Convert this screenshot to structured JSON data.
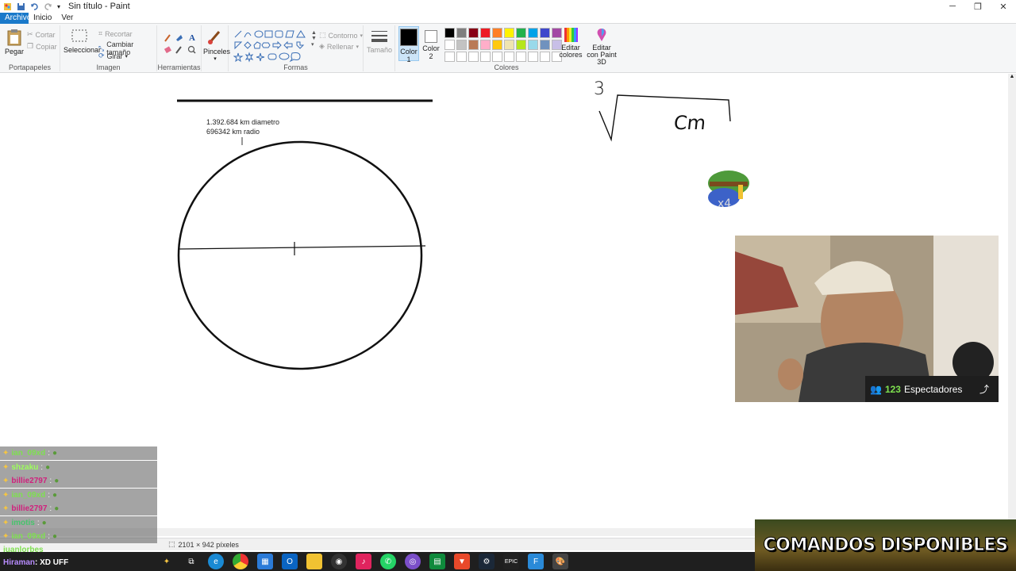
{
  "window": {
    "title": "Sin título - Paint",
    "controls": {
      "minimize": "─",
      "maximize": "❐",
      "close": "✕"
    }
  },
  "menu": {
    "tabs": [
      "Archivo",
      "Inicio",
      "Ver"
    ]
  },
  "ribbon": {
    "clipboard": {
      "label": "Portapapeles",
      "paste": "Pegar",
      "cut": "Cortar",
      "copy": "Copiar"
    },
    "image": {
      "label": "Imagen",
      "select": "Seleccionar",
      "crop": "Recortar",
      "resize": "Cambiar tamaño",
      "rotate": "Girar"
    },
    "tools": {
      "label": "Herramientas"
    },
    "brushes": {
      "label": "Pinceles"
    },
    "shapes": {
      "label": "Formas",
      "outline": "Contorno",
      "fill": "Rellenar"
    },
    "size": {
      "label": "Tamaño"
    },
    "colors": {
      "label": "Colores",
      "color1": "Color 1",
      "color2": "Color 2",
      "edit": "Editar colores",
      "paint3d": "Editar con Paint 3D",
      "color1_value": "#000000",
      "color2_value": "#ffffff",
      "palette": [
        "#000000",
        "#7f7f7f",
        "#880015",
        "#ed1c24",
        "#ff7f27",
        "#fff200",
        "#22b14c",
        "#00a2e8",
        "#3f48cc",
        "#a349a4",
        "#ffffff",
        "#c3c3c3",
        "#b97a57",
        "#ffaec9",
        "#ffc90e",
        "#efe4b0",
        "#b5e61d",
        "#99d9ea",
        "#7092be",
        "#c8bfe7",
        "#ffffff",
        "#ffffff",
        "#ffffff",
        "#ffffff",
        "#ffffff",
        "#ffffff",
        "#ffffff",
        "#ffffff",
        "#ffffff",
        "#ffffff"
      ]
    }
  },
  "canvas": {
    "note_line1": "1.392.684 km diametro",
    "note_line2": "696342 km radio",
    "handwriting_index": "3",
    "handwriting_unit": "Cm"
  },
  "status": {
    "dimensions": "2101 × 942 píxeles"
  },
  "stream": {
    "viewers_count": "123",
    "viewers_label": "Espectadores",
    "commands": "COMANDOS DISPONIBLES",
    "chat": [
      {
        "user": "ian_09xd",
        "color": "#7ee04f",
        "msg": ""
      },
      {
        "user": "shzaku",
        "color": "#9cff5a",
        "msg": ""
      },
      {
        "user": "billie2797",
        "color": "#d0217d",
        "msg": ""
      },
      {
        "user": "ian_09xd",
        "color": "#7ee04f",
        "msg": ""
      },
      {
        "user": "billie2797",
        "color": "#d0217d",
        "msg": ""
      },
      {
        "user": "imotis",
        "color": "#46c46b",
        "msg": ""
      },
      {
        "user": "ian_09xd",
        "color": "#7ee04f",
        "msg": ""
      }
    ],
    "chat_extra_user": "juanlorbes",
    "last_user": "Hiraman",
    "last_msg": "XD UFF"
  }
}
